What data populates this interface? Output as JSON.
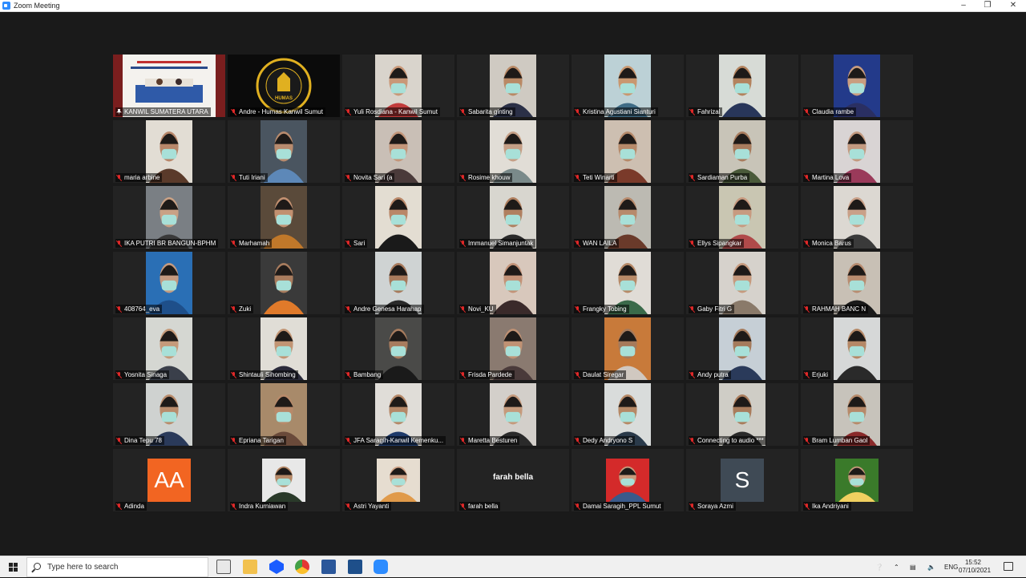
{
  "window": {
    "title": "Zoom Meeting"
  },
  "meeting": {
    "rows": [
      [
        {
          "name": "KANWIL SUMATERA UTARA",
          "kind": "screen",
          "active": true,
          "pinned": true
        },
        {
          "name": "Andre - Humas Kanwil Sumut",
          "kind": "logo",
          "logo_text": "HUMAS"
        },
        {
          "name": "Yuli Rosdiana - Kanwil Sumut",
          "kind": "video",
          "bg": "#d9d4cc",
          "skin": "#c99878",
          "shirt": "#c23b3b"
        },
        {
          "name": "Sabarita ginting",
          "kind": "video",
          "bg": "#cfcac2",
          "skin": "#b98965",
          "shirt": "#2b3047"
        },
        {
          "name": "Kristina Agustiani Sianturi",
          "kind": "video",
          "bg": "#bcd1d6",
          "skin": "#c9976f",
          "shirt": "#3f6c86"
        },
        {
          "name": "Fahrizal",
          "kind": "video",
          "bg": "#d7dbd6",
          "skin": "#b3835e",
          "shirt": "#28365a"
        },
        {
          "name": "Claudia rambe",
          "kind": "video",
          "bg": "#233a8a",
          "skin": "#c99d80",
          "shirt": "#2a2f62"
        }
      ],
      [
        {
          "name": "maria arbine",
          "kind": "video",
          "bg": "#e2ddd4",
          "skin": "#b8876a",
          "shirt": "#5a3a2a"
        },
        {
          "name": "Tuti Iriani",
          "kind": "video",
          "bg": "#4a5560",
          "skin": "#b88b6e",
          "shirt": "#5d88b8"
        },
        {
          "name": "Novita Sari (a",
          "kind": "video",
          "bg": "#c9bfb6",
          "skin": "#c3967a",
          "shirt": "#4a3a3a"
        },
        {
          "name": "Rosime khouw",
          "kind": "video",
          "bg": "#e1ddd6",
          "skin": "#c59f86",
          "shirt": "#7a8a8a"
        },
        {
          "name": "Teti Winarti",
          "kind": "video",
          "bg": "#cdbfb1",
          "skin": "#b68a6a",
          "shirt": "#7a3a2a"
        },
        {
          "name": "Sardiaman Purba",
          "kind": "video",
          "bg": "#c8c4b8",
          "skin": "#a87c5e",
          "shirt": "#4a5a3a"
        },
        {
          "name": "Martina Lova",
          "kind": "video",
          "bg": "#d9d4d4",
          "skin": "#c39a80",
          "shirt": "#9a3a5a"
        }
      ],
      [
        {
          "name": "IKA PUTRI BR BANGUN-BPHM",
          "kind": "video",
          "bg": "#7a7f84",
          "skin": "#c9a185",
          "shirt": "#3a3a3a"
        },
        {
          "name": "Marhamah",
          "kind": "video",
          "bg": "#5a4a3a",
          "skin": "#c29070",
          "shirt": "#c0782a"
        },
        {
          "name": "Sari",
          "kind": "video",
          "bg": "#e3ddd2",
          "skin": "#b98768",
          "shirt": "#1a1a1a"
        },
        {
          "name": "Immanuel Simanjuntak",
          "kind": "video",
          "bg": "#d8d6cf",
          "skin": "#b08060",
          "shirt": "#2a2a2a"
        },
        {
          "name": "WAN LAILA",
          "kind": "video",
          "bg": "#bcbab2",
          "skin": "#b78a6c",
          "shirt": "#6a3a2a"
        },
        {
          "name": "Ellys Sipangkar",
          "kind": "video",
          "bg": "#c9c6b2",
          "skin": "#c79a80",
          "shirt": "#b04a4a"
        },
        {
          "name": "Monica Barus",
          "kind": "video",
          "bg": "#dcd8d2",
          "skin": "#c9a088",
          "shirt": "#3a3a3a"
        }
      ],
      [
        {
          "name": "408764_eva",
          "kind": "video",
          "bg": "#2a6fb5",
          "skin": "#c49a80",
          "shirt": "#1e4f8a"
        },
        {
          "name": "Zuki",
          "kind": "video",
          "bg": "#3a3a3a",
          "skin": "#a87c5e",
          "shirt": "#e07a2a"
        },
        {
          "name": "Andre Genesa Harahap",
          "kind": "video",
          "bg": "#cfd3d3",
          "skin": "#a87a5c",
          "shirt": "#2a2a2a"
        },
        {
          "name": "Novi_KU",
          "kind": "video",
          "bg": "#d8c8bc",
          "skin": "#c39378",
          "shirt": "#3a2a2a"
        },
        {
          "name": "Frangky Tobing",
          "kind": "video",
          "bg": "#e0dcd6",
          "skin": "#b78a68",
          "shirt": "#3a6a4a"
        },
        {
          "name": "Gaby Fitri G",
          "kind": "video",
          "bg": "#d6d2cc",
          "skin": "#c69a7e",
          "shirt": "#8a7a6a"
        },
        {
          "name": "RAHMAH BANC N",
          "kind": "video",
          "bg": "#c8c0b5",
          "skin": "#b88c70",
          "shirt": "#1a1a1a"
        }
      ],
      [
        {
          "name": "Yosnita Sinaga",
          "kind": "video",
          "bg": "#d5d7d2",
          "skin": "#c59a7a",
          "shirt": "#3a3f4a"
        },
        {
          "name": "Shintauli Sihombing",
          "kind": "video",
          "bg": "#e0ddd6",
          "skin": "#c29574",
          "shirt": "#2a2a3a"
        },
        {
          "name": "Bambang",
          "kind": "video",
          "bg": "#4a4a48",
          "skin": "#a87c5e",
          "shirt": "#1a1a1a"
        },
        {
          "name": "Frisda Pardede",
          "kind": "video",
          "bg": "#8a7a70",
          "skin": "#c09274",
          "shirt": "#4a3a3a"
        },
        {
          "name": "Daulat Siregar",
          "kind": "video",
          "bg": "#c87a3a",
          "skin": "#a67a5a",
          "shirt": "#d0c8c0"
        },
        {
          "name": "Andy putra",
          "kind": "video",
          "bg": "#c6cfd6",
          "skin": "#a57b5c",
          "shirt": "#2a3a5a"
        },
        {
          "name": "Erjuki",
          "kind": "video",
          "bg": "#d6d8d8",
          "skin": "#b58866",
          "shirt": "#2a2a2a"
        }
      ],
      [
        {
          "name": "Dina Tepu 78",
          "kind": "video",
          "bg": "#cfd2d0",
          "skin": "#b98c6c",
          "shirt": "#2a3a5a"
        },
        {
          "name": "Epriana Tarigan",
          "kind": "video",
          "bg": "#a88a6a",
          "skin": "#b88a6a",
          "shirt": "#6a4a3a"
        },
        {
          "name": "JFA Saragih-Kanwil Kemenku...",
          "kind": "video",
          "bg": "#e0ddd8",
          "skin": "#b58868",
          "shirt": "#1e3a6a"
        },
        {
          "name": "Maretta Besturen",
          "kind": "video",
          "bg": "#d3cfca",
          "skin": "#c59a7c",
          "shirt": "#2a2a2a"
        },
        {
          "name": "Dedy Andryono S",
          "kind": "video",
          "bg": "#d9dcdb",
          "skin": "#b68966",
          "shirt": "#2a3a4a"
        },
        {
          "name": "Connecting to audio ***",
          "kind": "video",
          "bg": "#cfcdc6",
          "skin": "#a97c5c",
          "shirt": "#2a2a2a"
        },
        {
          "name": "Bram Lumban Gaol",
          "kind": "video",
          "bg": "#c7c3bb",
          "skin": "#b78a6a",
          "shirt": "#8a2a2a"
        }
      ],
      [
        {
          "name": "Adinda",
          "kind": "avatar",
          "initials": "AA",
          "avatar_color": "#f26522"
        },
        {
          "name": "Indra Kurniawan",
          "kind": "photo",
          "bg": "#e8e8e8",
          "skin": "#b58866",
          "shirt": "#2a3a2a"
        },
        {
          "name": "Astri Yayanti",
          "kind": "photo",
          "bg": "#e6ddd0",
          "skin": "#d0a488",
          "shirt": "#e09a4a"
        },
        {
          "name": "farah bella",
          "kind": "nameonly",
          "display": "farah bella"
        },
        {
          "name": "Damai Saragih_PPL Sumut",
          "kind": "photo",
          "bg": "#d42a2a",
          "skin": "#c99a7c",
          "shirt": "#3a5a8a"
        },
        {
          "name": "Soraya Azmi",
          "kind": "avatar",
          "initials": "S",
          "avatar_color": "#3f4a55"
        },
        {
          "name": "Ika Andriyani",
          "kind": "photo",
          "bg": "#3a7a2a",
          "skin": "#c49a7a",
          "shirt": "#f0d060"
        }
      ]
    ]
  },
  "taskbar": {
    "search_placeholder": "Type here to search",
    "language": "ENG",
    "time": "15:52",
    "date": "07/10/2021"
  },
  "colors": {
    "active_speaker": "#e6e63a",
    "mute": "#e02828",
    "background": "#1a1a1a"
  }
}
